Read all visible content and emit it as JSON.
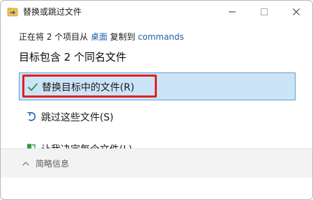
{
  "window": {
    "title": "替换或跳过文件"
  },
  "copy_info": {
    "prefix": "正在将 2 个项目从 ",
    "source": "桌面",
    "middle": " 复制到 ",
    "destination": "commands"
  },
  "heading": "目标包含 2 个同名文件",
  "options": {
    "replace": {
      "label": "替换目标中的文件(R)",
      "icon": "checkmark-icon",
      "selected": true
    },
    "skip": {
      "label": "跳过这些文件(S)",
      "icon": "skip-arrow-icon"
    },
    "decide": {
      "label": "让我决定每个文件(L)",
      "icon": "compare-files-icon"
    }
  },
  "footer": {
    "details_label": "简略信息",
    "details_icon": "chevron-up-icon"
  },
  "colors": {
    "accent": "#1f5fa8",
    "selection_bg": "#cce4f7",
    "selection_border": "#5a9fd8",
    "annotation_red": "#e02020",
    "check_green": "#2e9e3e"
  }
}
